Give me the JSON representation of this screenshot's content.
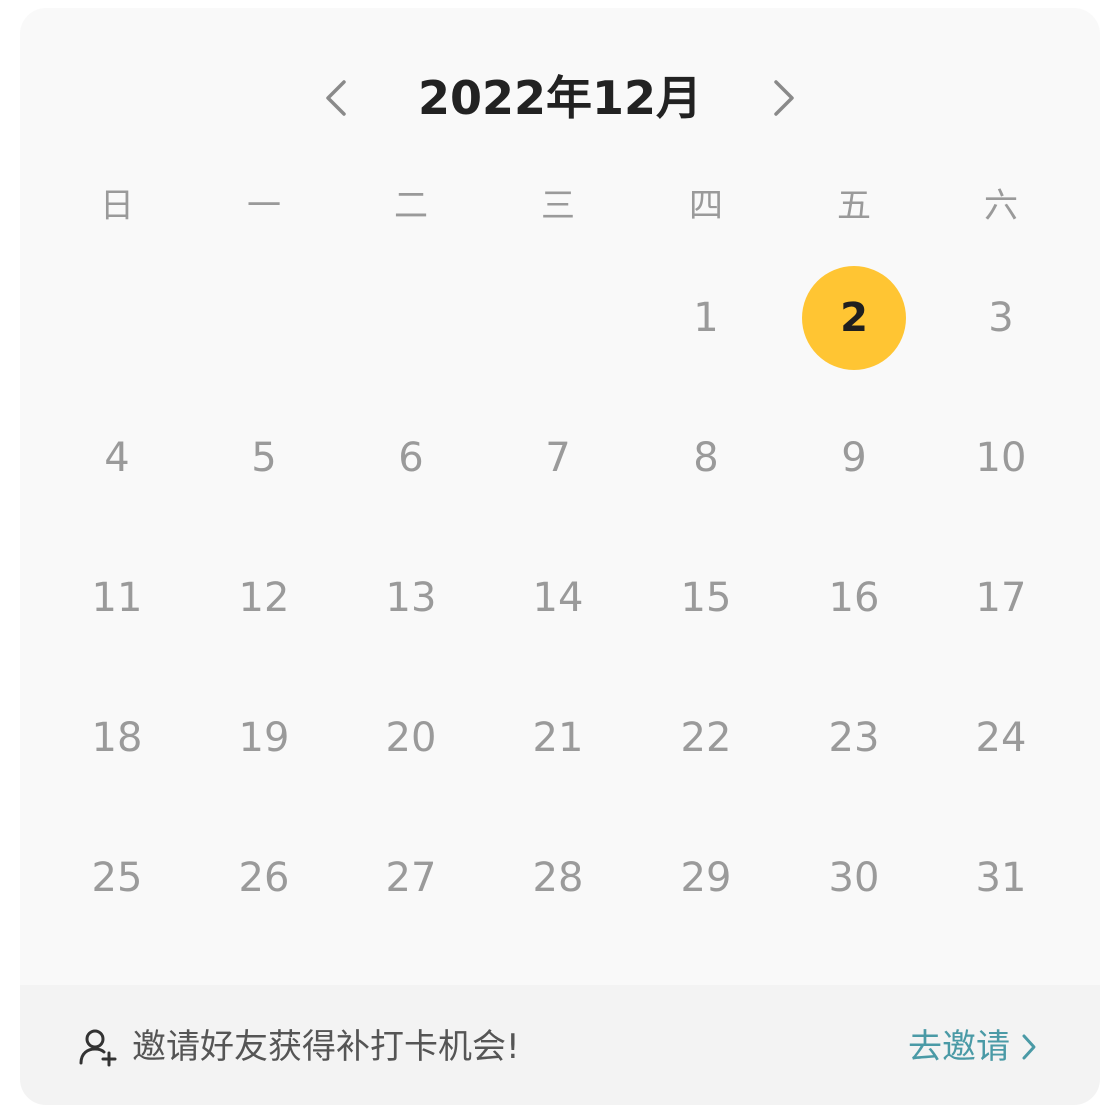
{
  "calendar": {
    "title": "2022年12月",
    "weekdays": [
      "日",
      "一",
      "二",
      "三",
      "四",
      "五",
      "六"
    ],
    "first_weekday_index": 4,
    "days_in_month": 31,
    "selected_day": 2,
    "accent_color": "#ffc533"
  },
  "footer": {
    "message": "邀请好友获得补打卡机会!",
    "link_label": "去邀请",
    "link_color": "#4a9aa6",
    "icon": "add-user-icon"
  },
  "icons": {
    "prev": "chevron-left-icon",
    "next": "chevron-right-icon"
  }
}
